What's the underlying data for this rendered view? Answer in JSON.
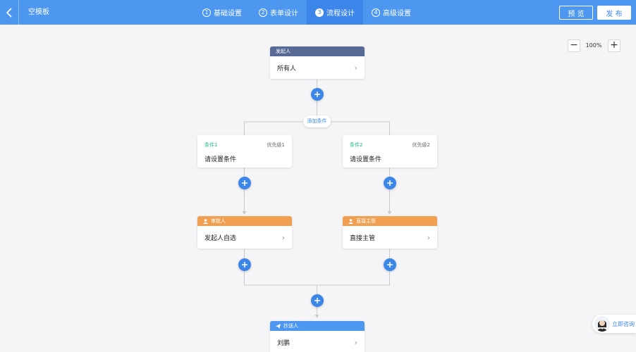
{
  "header": {
    "title": "空模板",
    "steps": [
      {
        "num": "1",
        "label": "基础设置"
      },
      {
        "num": "2",
        "label": "表单设计"
      },
      {
        "num": "3",
        "label": "流程设计"
      },
      {
        "num": "4",
        "label": "高级设置"
      }
    ],
    "active_step": 3,
    "preview_label": "预 览",
    "publish_label": "发 布"
  },
  "zoom": {
    "minus": "−",
    "level": "100%",
    "plus": "+"
  },
  "flow": {
    "initiator": {
      "title": "发起人",
      "value": "所有人"
    },
    "add_condition_label": "添加条件",
    "branches": [
      {
        "condition": {
          "name": "条件1",
          "priority": "优先级1",
          "text": "请设置条件"
        },
        "approver": {
          "title": "审批人",
          "value": "发起人自选"
        }
      },
      {
        "condition": {
          "name": "条件2",
          "priority": "优先级2",
          "text": "请设置条件"
        },
        "approver": {
          "title": "直接主管",
          "value": "直接主管"
        }
      }
    ],
    "cc": {
      "title": "抄送人",
      "value": "刘鹏"
    }
  },
  "consult": {
    "label": "立即咨询"
  },
  "icons": {
    "back": "chevron-left-icon",
    "add": "plus-icon",
    "user": "user-icon",
    "send": "paper-plane-icon",
    "chevron": "chevron-right-icon"
  },
  "colors": {
    "header_bg": "#4d97f0",
    "active_step_bg": "#3b86e8",
    "initiator_head": "#576a95",
    "approver_head": "#f0a050",
    "cc_head": "#4d97f0",
    "condition_name": "#15bc83",
    "add_button": "#3b86e8"
  }
}
